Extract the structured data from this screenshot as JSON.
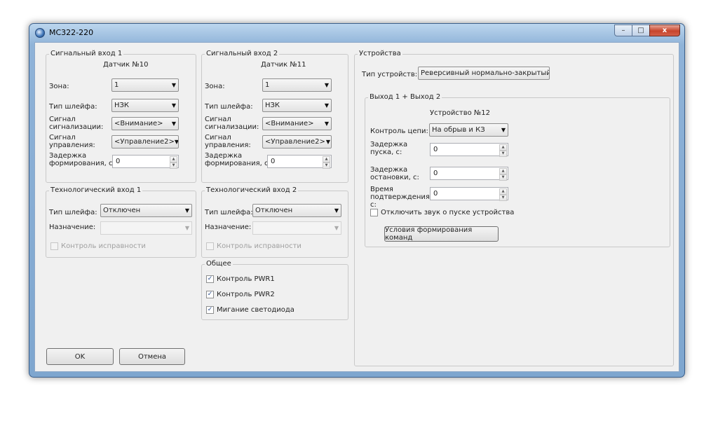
{
  "window": {
    "title": "MC322-220",
    "minimize_label": "–",
    "maximize_label": "□",
    "close_label": "x"
  },
  "input1": {
    "legend": "Сигнальный вход 1",
    "sensor": "Датчик №10",
    "zone_label": "Зона:",
    "zone_value": "1",
    "loop_type_label": "Тип шлейфа:",
    "loop_type_value": "НЗК",
    "alarm_signal_label": "Сигнал сигнализации:",
    "alarm_signal_value": "<Внимание>",
    "control_signal_label": "Сигнал управления:",
    "control_signal_value": "<Управление2>",
    "delay_label": "Задержка формирования, с:",
    "delay_value": "0"
  },
  "input2": {
    "legend": "Сигнальный вход 2",
    "sensor": "Датчик №11",
    "zone_label": "Зона:",
    "zone_value": "1",
    "loop_type_label": "Тип шлейфа:",
    "loop_type_value": "НЗК",
    "alarm_signal_label": "Сигнал сигнализации:",
    "alarm_signal_value": "<Внимание>",
    "control_signal_label": "Сигнал управления:",
    "control_signal_value": "<Управление2>",
    "delay_label": "Задержка формирования, с:",
    "delay_value": "0"
  },
  "tech1": {
    "legend": "Технологический вход 1",
    "loop_type_label": "Тип шлейфа:",
    "loop_type_value": "Отключен",
    "purpose_label": "Назначение:",
    "purpose_value": "",
    "health_check_label": "Контроль исправности",
    "health_check_checked": false
  },
  "tech2": {
    "legend": "Технологический вход 2",
    "loop_type_label": "Тип шлейфа:",
    "loop_type_value": "Отключен",
    "purpose_label": "Назначение:",
    "purpose_value": "",
    "health_check_label": "Контроль исправности",
    "health_check_checked": false
  },
  "common": {
    "legend": "Общее",
    "items": [
      {
        "label": "Контроль PWR1",
        "checked": true
      },
      {
        "label": "Контроль PWR2",
        "checked": true
      },
      {
        "label": "Мигание светодиода",
        "checked": true
      }
    ]
  },
  "devices": {
    "legend": "Устройства",
    "type_label": "Тип устройств:",
    "type_value": "Реверсивный нормально-закрытый",
    "output": {
      "legend": "Выход 1 + Выход 2",
      "device": "Устройство №12",
      "circuit_label": "Контроль цепи:",
      "circuit_value": "На обрыв и КЗ",
      "start_delay_label": "Задержка пуска, с:",
      "start_delay_value": "0",
      "stop_delay_label": "Задержка остановки, с:",
      "stop_delay_value": "0",
      "confirm_label": "Время подтверждения, с:",
      "confirm_value": "0",
      "mute_label": "Отключить звук о пуске устройства",
      "mute_checked": false,
      "conditions_button": "Условия формирования команд"
    }
  },
  "buttons": {
    "ok": "OK",
    "cancel": "Отмена"
  },
  "icons": {
    "arrow": "▼",
    "spin_up": "▲",
    "spin_down": "▼",
    "check": "✓"
  }
}
